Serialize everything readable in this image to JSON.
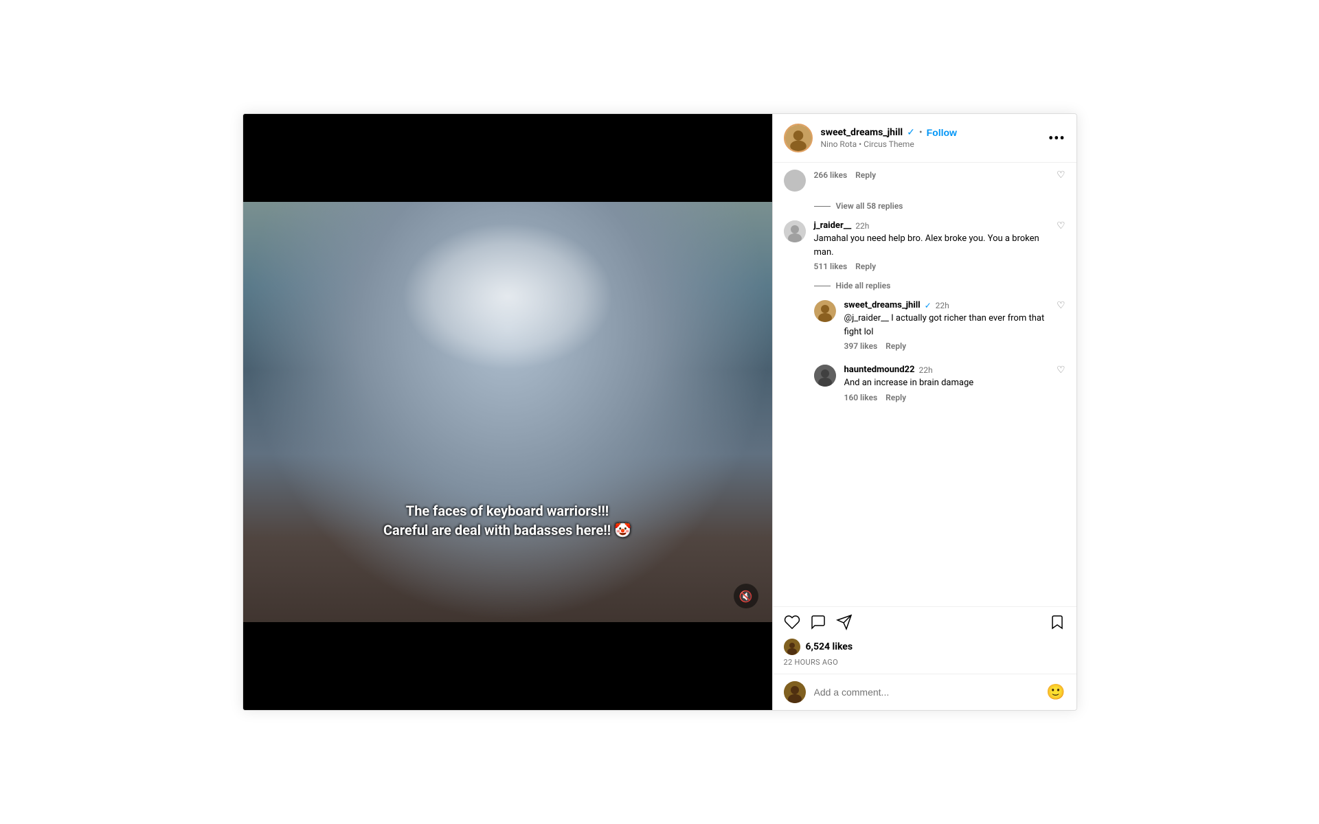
{
  "header": {
    "username": "sweet_dreams_jhill",
    "verified": true,
    "follow_label": "Follow",
    "music_artist": "Nino Rota",
    "music_track": "Circus Theme",
    "more_label": "•••"
  },
  "media": {
    "overlay_text": "The faces of keyboard warriors!!!\nCareful are deal with badasses here!! 🤡",
    "mute_label": "🔇"
  },
  "comments": [
    {
      "id": "comment-top-likes-reply",
      "likes_text": "266 likes",
      "reply_text": "Reply"
    },
    {
      "id": "view-all-58",
      "text": "View all 58 replies"
    },
    {
      "id": "j_raider",
      "username": "j_raider__",
      "time": "22h",
      "text": "Jamahal you need help bro. Alex broke you. You a broken man.",
      "likes": "511 likes",
      "reply": "Reply"
    },
    {
      "id": "hide-replies",
      "text": "Hide all replies"
    },
    {
      "id": "sweet_reply",
      "username": "sweet_dreams_jhill",
      "verified": true,
      "time": "22h",
      "text": "@j_raider__ I actually got richer than ever from that fight lol",
      "likes": "397 likes",
      "reply": "Reply"
    },
    {
      "id": "hauntedmound",
      "username": "hauntedmound22",
      "time": "22h",
      "text": "And an increase in brain damage",
      "likes": "160 likes",
      "reply": "Reply"
    }
  ],
  "actions": {
    "likes_count": "6,524 likes",
    "timestamp": "22 hours ago",
    "add_comment_placeholder": "Add a comment...",
    "heart_icon": "♡",
    "comment_icon": "○",
    "send_icon": "➢",
    "bookmark_icon": "⊓",
    "emoji_icon": "🙂"
  }
}
